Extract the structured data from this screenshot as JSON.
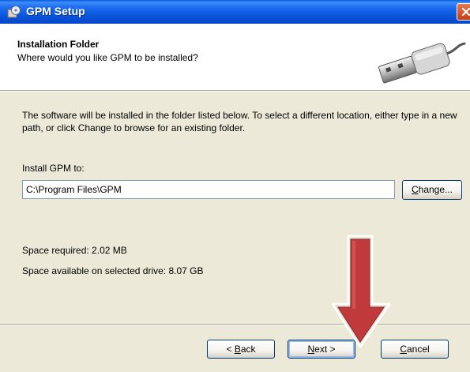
{
  "window": {
    "title": "GPM Setup",
    "title_icon": "setup-disc-icon",
    "close_icon": "close-icon"
  },
  "header": {
    "title": "Installation Folder",
    "subtitle": "Where would you like GPM to be installed?",
    "graphic_icon": "usb-plug-icon"
  },
  "body": {
    "description": "The software will be installed in the folder listed below. To select a different location, either type in a new path, or click Change to browse for an existing folder.",
    "install_label": "Install GPM to:",
    "install_path": "C:\\Program Files\\GPM",
    "change_button": {
      "before": "",
      "accel": "C",
      "after": "hange..."
    },
    "space_required": "Space required: 2.02 MB",
    "space_available": "Space available on selected drive: 8.07 GB"
  },
  "footer": {
    "back_button": {
      "before": "< ",
      "accel": "B",
      "after": "ack"
    },
    "next_button": {
      "before": "",
      "accel": "N",
      "after": "ext >"
    },
    "cancel_button": {
      "before": "",
      "accel": "C",
      "after": "ancel"
    }
  },
  "annotation": {
    "arrow_icon": "down-arrow-icon",
    "arrow_color": "#c0393b"
  },
  "colors": {
    "titlebar": "#0854d8",
    "dialog_background": "#ece9d8",
    "header_background": "#ffffff",
    "close_button": "#d0532b"
  }
}
